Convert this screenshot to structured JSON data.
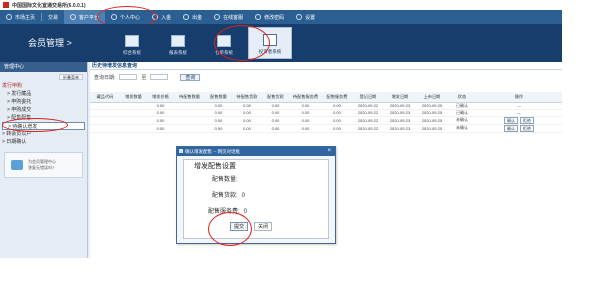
{
  "window": {
    "title": "中国国际文化宣通交易所(6.0.0.1)"
  },
  "topnav": {
    "items": [
      {
        "label": "市场主页",
        "active": false
      },
      {
        "label": "交易",
        "active": false
      },
      {
        "label": "客户平台",
        "active": true
      },
      {
        "label": "个人中心",
        "active": false
      },
      {
        "label": "入金",
        "active": false
      },
      {
        "label": "出金",
        "active": false
      },
      {
        "label": "在线客服",
        "active": false
      },
      {
        "label": "修改密码",
        "active": false
      },
      {
        "label": "设置",
        "active": false
      }
    ]
  },
  "subheader": {
    "title": "会员管理  >",
    "tools": [
      {
        "label": "综合系统",
        "active": false
      },
      {
        "label": "报表系统",
        "active": false
      },
      {
        "label": "仓单系统",
        "active": false
      },
      {
        "label": "投资者系统",
        "active": true
      }
    ]
  },
  "sidebar": {
    "header": "管理中心",
    "tool_button": "折叠菜单",
    "groups": [
      {
        "label": "发行申购",
        "red": true,
        "items": [
          {
            "label": "> 发行藏品",
            "selected": false
          },
          {
            "label": "> 申购委托",
            "selected": false
          },
          {
            "label": "> 申购成交",
            "selected": false
          },
          {
            "label": "> 配售配售",
            "selected": false
          },
          {
            "label": "> 待确认增发",
            "selected": true
          }
        ]
      },
      {
        "label": "> 转会员以户",
        "red": false,
        "items": []
      },
      {
        "label": "> 日期确认",
        "red": false,
        "items": []
      }
    ],
    "card_text_line1": "为会员管理中心",
    "card_text_line2": "答复无错误吗?"
  },
  "main": {
    "title": "历史待增发信息查询",
    "query": {
      "label_date": "查询日期:",
      "label_to": "至",
      "button": "查询"
    },
    "table": {
      "columns": [
        "藏品代码",
        "增发数量",
        "增发价格",
        "待配售数量",
        "配售数量",
        "待配售货款",
        "配售货款",
        "待配售服务费",
        "配售服务费",
        "登记日期",
        "增发日期",
        "上市日期",
        "状态",
        "操作"
      ],
      "rows": [
        [
          "",
          "",
          "0.00",
          "",
          "0.00",
          "0.00",
          "0.00",
          "0.00",
          "0.00",
          "2020-09-22",
          "2020-09-23",
          "2020-09-25",
          "已确认",
          ""
        ],
        [
          "",
          "",
          "0.00",
          "",
          "0.00",
          "0.00",
          "0.00",
          "0.00",
          "0.00",
          "2020-09-22",
          "2020-09-23",
          "2020-09-25",
          "已确认",
          ""
        ],
        [
          "",
          "",
          "0.00",
          "",
          "0.00",
          "0.00",
          "0.00",
          "0.00",
          "0.00",
          "2020-09-22",
          "2020-09-23",
          "2020-09-25",
          "未确认",
          ""
        ],
        [
          "",
          "",
          "0.00",
          "",
          "0.00",
          "0.00",
          "0.00",
          "0.00",
          "0.00",
          "2020-09-22",
          "2020-09-23",
          "2020-09-25",
          "未确认",
          ""
        ]
      ],
      "row_ops": [
        {
          "dash": "—",
          "confirm": "",
          "reject": ""
        },
        {
          "dash": "—",
          "confirm": "",
          "reject": ""
        },
        {
          "dash": "",
          "confirm": "确认",
          "reject": "拒绝"
        },
        {
          "dash": "",
          "confirm": "确认",
          "reject": "拒绝"
        }
      ]
    }
  },
  "dialog": {
    "title": "确认增发配售 -- 网页对话框",
    "heading": "增发配售设置",
    "qty_label": "配售数量:",
    "amount_label": "配售货款:",
    "amount_value": "0",
    "fee_label": "配售服务费:",
    "fee_value": "0",
    "submit": "提交",
    "close": "关闭"
  }
}
